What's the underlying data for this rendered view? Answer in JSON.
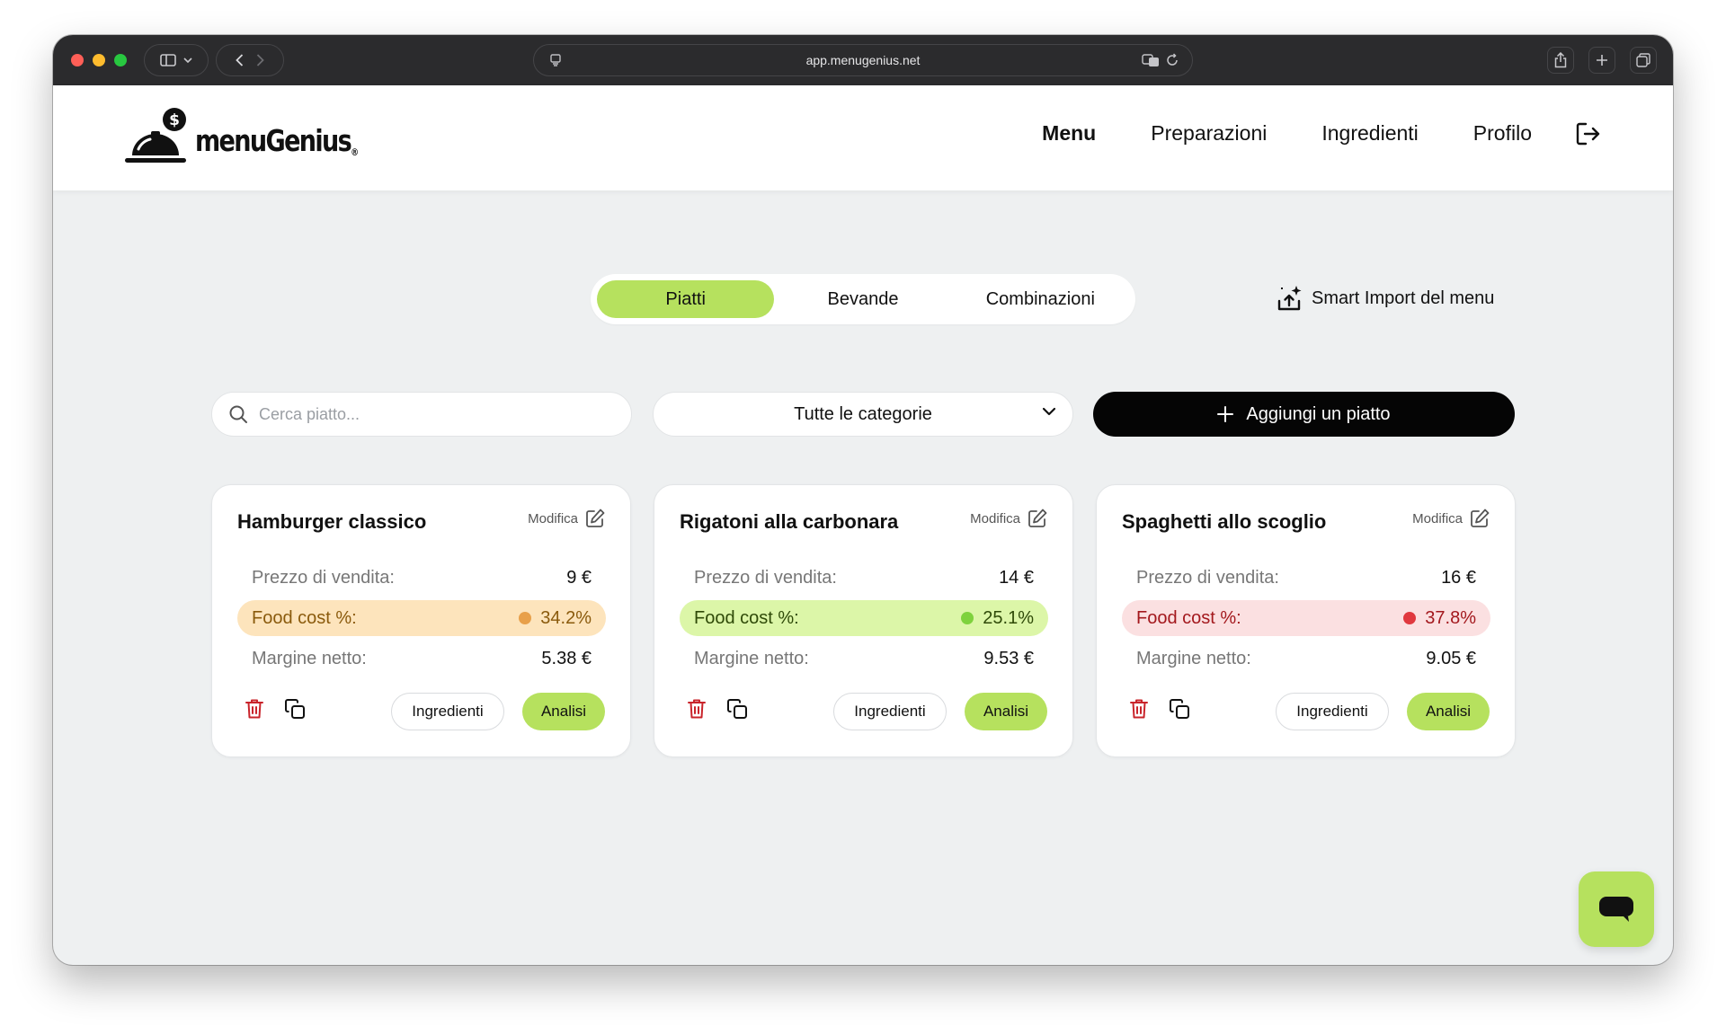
{
  "browser": {
    "url": "app.menugenius.net"
  },
  "app": {
    "brand": "menuGenius",
    "brand_mark": "®"
  },
  "nav": {
    "items": [
      {
        "label": "Menu",
        "active": true
      },
      {
        "label": "Preparazioni",
        "active": false
      },
      {
        "label": "Ingredienti",
        "active": false
      },
      {
        "label": "Profilo",
        "active": false
      }
    ],
    "logout_icon": "logout-icon"
  },
  "tabs": [
    {
      "label": "Piatti",
      "active": true
    },
    {
      "label": "Bevande",
      "active": false
    },
    {
      "label": "Combinazioni",
      "active": false
    }
  ],
  "smart_import": {
    "label": "Smart Import del menu",
    "icon": "upload-sparkle-icon"
  },
  "toolbar": {
    "search_placeholder": "Cerca piatto...",
    "search_value": "",
    "category_selected": "Tutte le categorie",
    "add_label": "Aggiungi un piatto"
  },
  "labels": {
    "edit": "Modifica",
    "price": "Prezzo di vendita:",
    "food_cost": "Food cost %:",
    "margin": "Margine netto:",
    "ingredients_btn": "Ingredienti",
    "analysis_btn": "Analisi"
  },
  "colors": {
    "accent": "#b6e15e",
    "warning_bg": "#fde4bc",
    "warning_text": "#8a5a0c",
    "warning_dot": "#e8a04a",
    "good_bg": "#dcf6a8",
    "good_text": "#2f4a08",
    "good_dot": "#7ed23d",
    "bad_bg": "#fbe0e1",
    "bad_text": "#a3181d",
    "bad_dot": "#e0383e"
  },
  "dishes": [
    {
      "name": "Hamburger classico",
      "price": "9 €",
      "food_cost": "34.2%",
      "status": "warning",
      "margin": "5.38 €"
    },
    {
      "name": "Rigatoni alla carbonara",
      "price": "14 €",
      "food_cost": "25.1%",
      "status": "good",
      "margin": "9.53 €"
    },
    {
      "name": "Spaghetti allo scoglio",
      "price": "16 €",
      "food_cost": "37.8%",
      "status": "bad",
      "margin": "9.05 €"
    }
  ],
  "chat": {
    "icon": "chat-icon"
  }
}
